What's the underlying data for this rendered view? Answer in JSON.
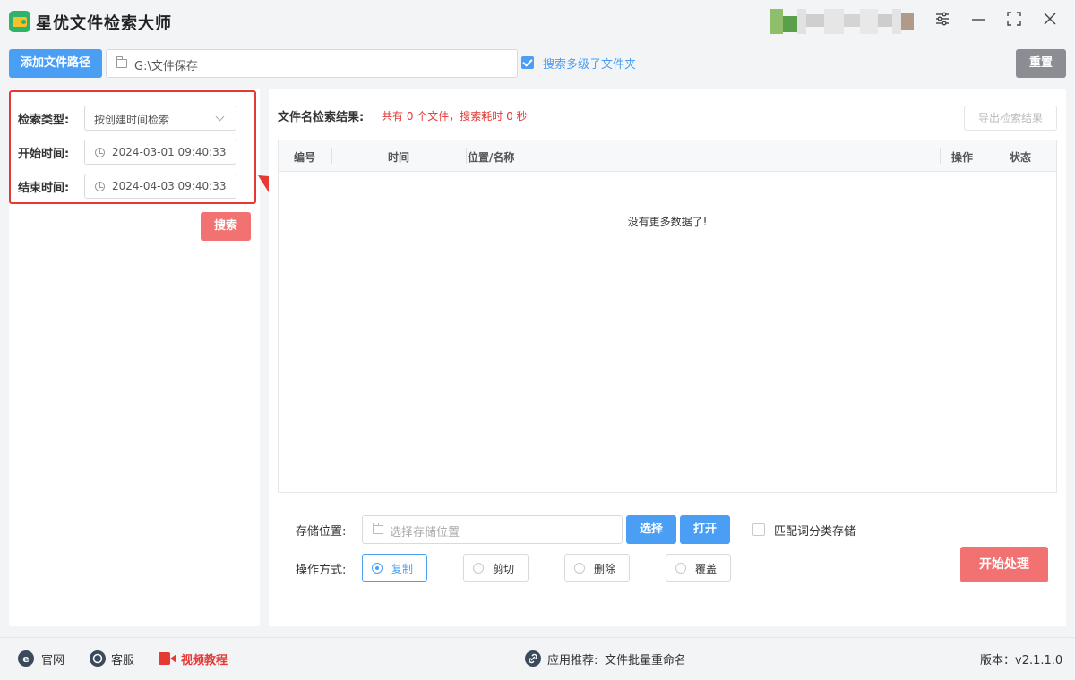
{
  "app": {
    "title": "星优文件检索大师"
  },
  "window_controls": {
    "settings_icon": "sliders-icon",
    "minimize_icon": "minimize-icon",
    "maximize_icon": "maximize-icon",
    "close_icon": "close-icon"
  },
  "toolbar": {
    "add_path_label": "添加文件路径",
    "path_value": "G:\\文件保存",
    "include_subfolders_label": "搜索多级子文件夹",
    "include_subfolders_checked": true,
    "reset_label": "重置"
  },
  "filter": {
    "type_label": "检索类型:",
    "type_value": "按创建时间检索",
    "start_label": "开始时间:",
    "start_value": "2024-03-01 09:40:33",
    "end_label": "结束时间:",
    "end_value": "2024-04-03 09:40:33",
    "search_label": "搜索"
  },
  "results": {
    "title": "文件名检索结果:",
    "stats": "共有 0 个文件，搜索耗时 0 秒",
    "export_label": "导出检索结果",
    "columns": [
      "编号",
      "时间",
      "位置/名称",
      "操作",
      "状态"
    ],
    "empty_text": "没有更多数据了!"
  },
  "storage": {
    "location_label": "存储位置:",
    "location_placeholder": "选择存储位置",
    "choose_label": "选择",
    "open_label": "打开",
    "match_label": "匹配词分类存储",
    "mode_label": "操作方式:",
    "modes": [
      "复制",
      "剪切",
      "删除",
      "覆盖"
    ],
    "selected_mode": "复制",
    "start_label": "开始处理"
  },
  "footer": {
    "website": "官网",
    "service": "客服",
    "tutorial": "视频教程",
    "recommend_label": "应用推荐:",
    "recommend_app": "文件批量重命名",
    "version": "版本：v2.1.1.0"
  },
  "colors": {
    "primary": "#4a9ff5",
    "danger": "#f27171",
    "highlight_border": "#e53935",
    "gray_button": "#8a8d91"
  }
}
